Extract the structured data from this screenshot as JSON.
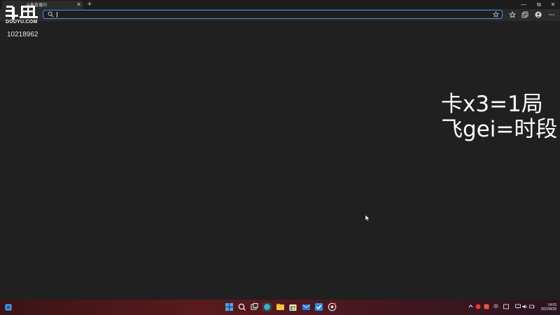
{
  "browser": {
    "tab": {
      "title": "斗鱼直播间",
      "close_label": "✕"
    },
    "new_tab_label": "+",
    "window_buttons": {
      "minimize": "—",
      "maximize": "⧉",
      "close": "✕"
    },
    "address_bar": {
      "value": "",
      "placeholder": ""
    },
    "toolbar_icons": [
      "favorites-icon",
      "collections-icon",
      "profile-icon",
      "more-icon"
    ]
  },
  "watermark": {
    "logo_name": "斗鱼",
    "logo_sub": "DOUYU.COM",
    "room_id": "10218962"
  },
  "overlay_note": {
    "line1": "卡x3=1局",
    "line2": "飞gei=时段"
  },
  "taskbar": {
    "apps": [
      "start-icon",
      "search-icon",
      "task-view-icon",
      "edge-icon",
      "file-explorer-icon",
      "store-icon",
      "mail-icon",
      "app-icon",
      "chrome-icon"
    ],
    "tray": {
      "ime": "中"
    },
    "clock": {
      "time": "14:03",
      "date": "2022/8/28"
    }
  },
  "colors": {
    "accent": "#4a8ee6",
    "background": "#202020"
  }
}
